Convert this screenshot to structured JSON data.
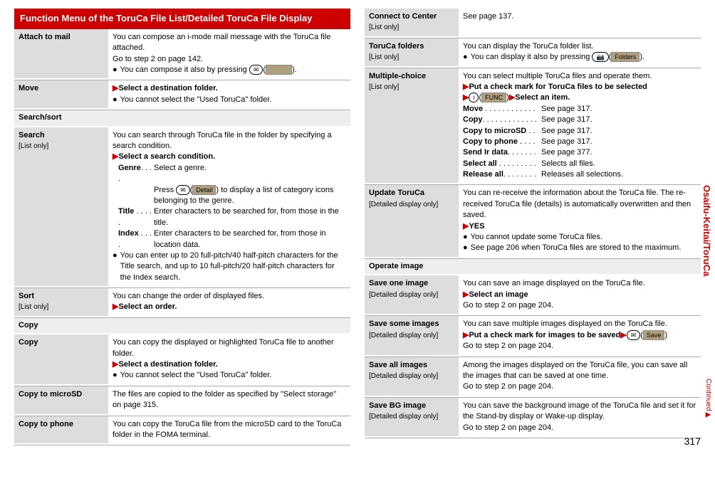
{
  "sideTab": "Osaifu-Keitai/ToruCa",
  "continued": "Continued",
  "pageNumber": "317",
  "header": "Function Menu of the ToruCa File List/Detailed ToruCa File Display",
  "left": {
    "attachToMail": {
      "label": "Attach to mail",
      "line1": "You can compose an i-mode mail message with the ToruCa file attached.",
      "line2": "Go to step 2 on page 142.",
      "bullet": "You can compose it also by pressing ",
      "key": "✉",
      "soft": "　　　",
      "tail": "."
    },
    "move": {
      "label": "Move",
      "action": "Select a destination folder.",
      "bullet": "You cannot select the \"Used ToruCa\" folder."
    },
    "searchSort": {
      "header": "Search/sort",
      "search": {
        "label": "Search",
        "sub": "[List only]",
        "line1": "You can search through ToruCa file in the folder by specifying a search condition.",
        "action": "Select a search condition.",
        "genreLabel": "Genre",
        "genreDots": ". . . .",
        "genreText": "Select a genre.",
        "genrePressPre": "Press ",
        "genreKey": "✉",
        "genreSoft": "Detail",
        "genrePressPost": " to display a list of category icons belonging to the genre.",
        "titleLabel": "Title",
        "titleDots": "  . . . . .",
        "titleText": "Enter characters to be searched for, from those in the title.",
        "indexLabel": "Index",
        "indexDots": "  . . . .",
        "indexText": "Enter characters to be searched for, from those in location data.",
        "bullet": "You can enter up to 20 full-pitch/40 half-pitch characters for the Title search, and up to 10 full-pitch/20 half-pitch characters for the Index search."
      },
      "sort": {
        "label": "Sort",
        "sub": "[List only]",
        "line1": "You can change the order of displayed files.",
        "action": "Select an order."
      }
    },
    "copy": {
      "header": "Copy",
      "copy": {
        "label": "Copy",
        "line1": "You can copy the displayed or highlighted ToruCa file to another folder.",
        "action": "Select a destination folder.",
        "bullet": "You cannot select the \"Used ToruCa\" folder."
      },
      "copyToMicroSD": {
        "label": "Copy to microSD",
        "text": "The files are copied to the folder as specified by \"Select storage\" on page 315."
      },
      "copyToPhone": {
        "label": "Copy to phone",
        "text": "You can copy the ToruCa file from the microSD card to the ToruCa folder in the FOMA terminal."
      }
    }
  },
  "right": {
    "connectToCenter": {
      "label": "Connect to Center",
      "sub": "[List only]",
      "text": "See page 137."
    },
    "torucaFolders": {
      "label": "ToruCa folders",
      "sub": "[List only]",
      "line1": "You can display the ToruCa folder list.",
      "bulletPre": "You can display it also by pressing ",
      "key": "📷",
      "soft": "Folders",
      "bulletPost": "."
    },
    "multipleChoice": {
      "label": "Multiple-choice",
      "sub": "[List only]",
      "line1": "You can select multiple ToruCa files and operate them.",
      "action1": "Put a check mark for ToruCa files to be selected",
      "key": "i",
      "soft": "FUNC",
      "action2": "Select an item.",
      "ops": [
        {
          "k": "Move",
          "d": "  . . . . . . . . . . . .",
          "v": "See page 317."
        },
        {
          "k": "Copy",
          "d": ". . . . . . . . . . . . .",
          "v": "See page 317."
        },
        {
          "k": "Copy to microSD",
          "d": " . .",
          "v": "See page 317."
        },
        {
          "k": "Copy to phone",
          "d": "  . . . .",
          "v": "See page 317."
        },
        {
          "k": "Send Ir data",
          "d": ". . . . . . .",
          "v": "See page 377."
        },
        {
          "k": "Select all",
          "d": "  . . . . . . . . .",
          "v": "Selects all files."
        },
        {
          "k": "Release all",
          "d": ". . . . . . . .",
          "v": "Releases all selections."
        }
      ]
    },
    "updateToruCa": {
      "label": "Update ToruCa",
      "sub": "[Detailed display only]",
      "line1": "You can re-receive the information about the ToruCa file. The re-received ToruCa file (details) is automatically overwritten and then saved.",
      "action": "YES",
      "bullet1": "You cannot update some ToruCa files.",
      "bullet2": "See page 206 when ToruCa files are stored to the maximum."
    },
    "operateImage": {
      "header": "Operate image",
      "saveOne": {
        "label": "Save one image",
        "sub": "[Detailed display only]",
        "line1": "You can save an image displayed on the ToruCa file.",
        "action": "Select an image",
        "line2": "Go to step 2 on page 204."
      },
      "saveSome": {
        "label": "Save some images",
        "sub": "[Detailed display only]",
        "line1": "You can save multiple images displayed on the ToruCa file.",
        "action": "Put a check mark for images to be saved",
        "key": "✉",
        "soft": "Save",
        "line2": "Go to step 2 on page 204."
      },
      "saveAll": {
        "label": "Save all images",
        "sub": "[Detailed display only]",
        "line1": "Among the images displayed on the ToruCa file, you can save all the images that can be saved at one time.",
        "line2": "Go to step 2 on page 204."
      },
      "saveBG": {
        "label": "Save BG image",
        "sub": "[Detailed display only]",
        "line1": "You can save the background image of the ToruCa file and set it for the Stand-by display or Wake-up display.",
        "line2": "Go to step 2 on page 204."
      }
    }
  }
}
